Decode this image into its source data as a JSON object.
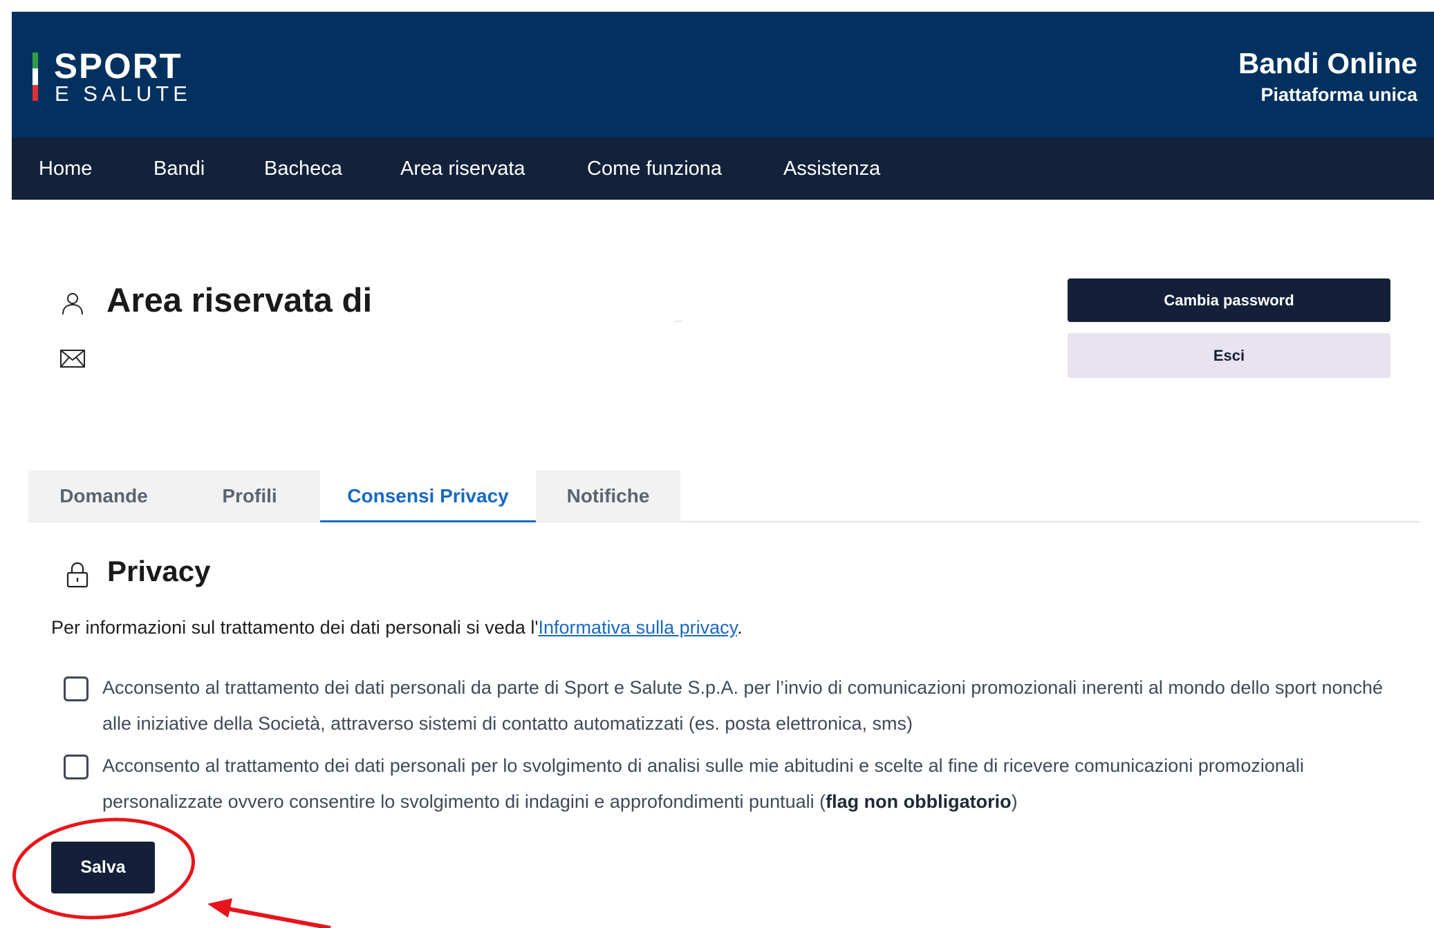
{
  "header": {
    "logo_line1": "SPORT",
    "logo_line2": "E SALUTE",
    "brand_title": "Bandi Online",
    "brand_subtitle": "Piattaforma unica"
  },
  "nav": {
    "items": [
      "Home",
      "Bandi",
      "Bacheca",
      "Area riservata",
      "Come funziona",
      "Assistenza"
    ]
  },
  "profile": {
    "title": "Area riservata di",
    "change_password_label": "Cambia password",
    "logout_label": "Esci"
  },
  "tabs": {
    "items": [
      "Domande",
      "Profili",
      "Consensi Privacy",
      "Notifiche"
    ],
    "active": "Consensi Privacy"
  },
  "privacy": {
    "heading": "Privacy",
    "info_prefix": "Per informazioni sul trattamento dei dati personali si veda l'",
    "info_link": "Informativa sulla privacy",
    "info_suffix": ".",
    "consent_1": "Acconsento al trattamento dei dati personali da parte di Sport e Salute S.p.A. per l’invio di comunicazioni promozionali inerenti al mondo dello sport nonché alle iniziative della Società, attraverso sistemi di contatto automatizzati (es. posta elettronica, sms)",
    "consent_1_checked": false,
    "consent_2_text": "Acconsento al trattamento dei dati personali per lo svolgimento di analisi sulle mie abitudini e scelte al fine di ricevere comunicazioni promozionali personalizzate ovvero consentire lo svolgimento di indagini e approfondimenti puntuali (",
    "consent_2_bold": "flag non obbligatorio",
    "consent_2_end": ")",
    "consent_2_checked": false,
    "save_label": "Salva"
  },
  "icons": {
    "user": "user-icon",
    "mail": "mail-icon",
    "lock": "lock-icon"
  },
  "colors": {
    "header_bg": "#023160",
    "navbar_bg": "#12223a",
    "primary_button": "#142039",
    "secondary_button": "#e8e3ee",
    "link": "#1769c4",
    "annotation": "#e8141b",
    "flag_green": "#2f9e44",
    "flag_white": "#ffffff",
    "flag_red": "#e03131"
  }
}
